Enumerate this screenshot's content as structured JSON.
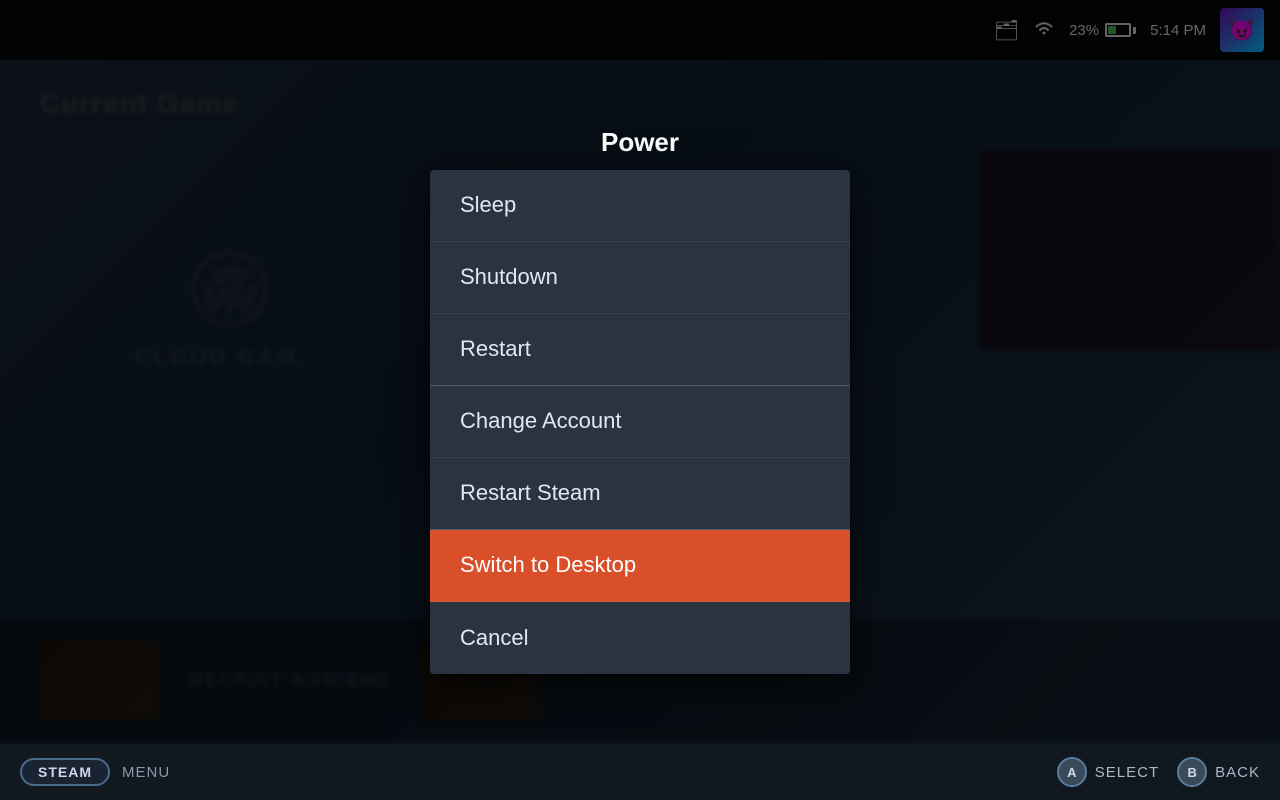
{
  "topbar": {
    "battery_percent": "23%",
    "time": "5:14 PM",
    "avatar_emoji": "😈"
  },
  "background": {
    "current_game_label": "Current Game",
    "cloud_gaming_text": "CLOUD GAM...",
    "recruit_text": "RECRUIT A FRIEND"
  },
  "modal": {
    "title": "Power",
    "items": [
      {
        "id": "sleep",
        "label": "Sleep",
        "highlighted": false,
        "section": 1
      },
      {
        "id": "shutdown",
        "label": "Shutdown",
        "highlighted": false,
        "section": 1
      },
      {
        "id": "restart",
        "label": "Restart",
        "highlighted": false,
        "section": 1
      },
      {
        "id": "change-account",
        "label": "Change Account",
        "highlighted": false,
        "section": 2
      },
      {
        "id": "restart-steam",
        "label": "Restart Steam",
        "highlighted": false,
        "section": 2
      },
      {
        "id": "switch-desktop",
        "label": "Switch to Desktop",
        "highlighted": true,
        "section": 3
      },
      {
        "id": "cancel",
        "label": "Cancel",
        "highlighted": false,
        "section": 3
      }
    ]
  },
  "bottombar": {
    "steam_label": "STEAM",
    "menu_label": "MENU",
    "select_label": "SELECT",
    "back_label": "BACK",
    "a_btn": "A",
    "b_btn": "B"
  }
}
